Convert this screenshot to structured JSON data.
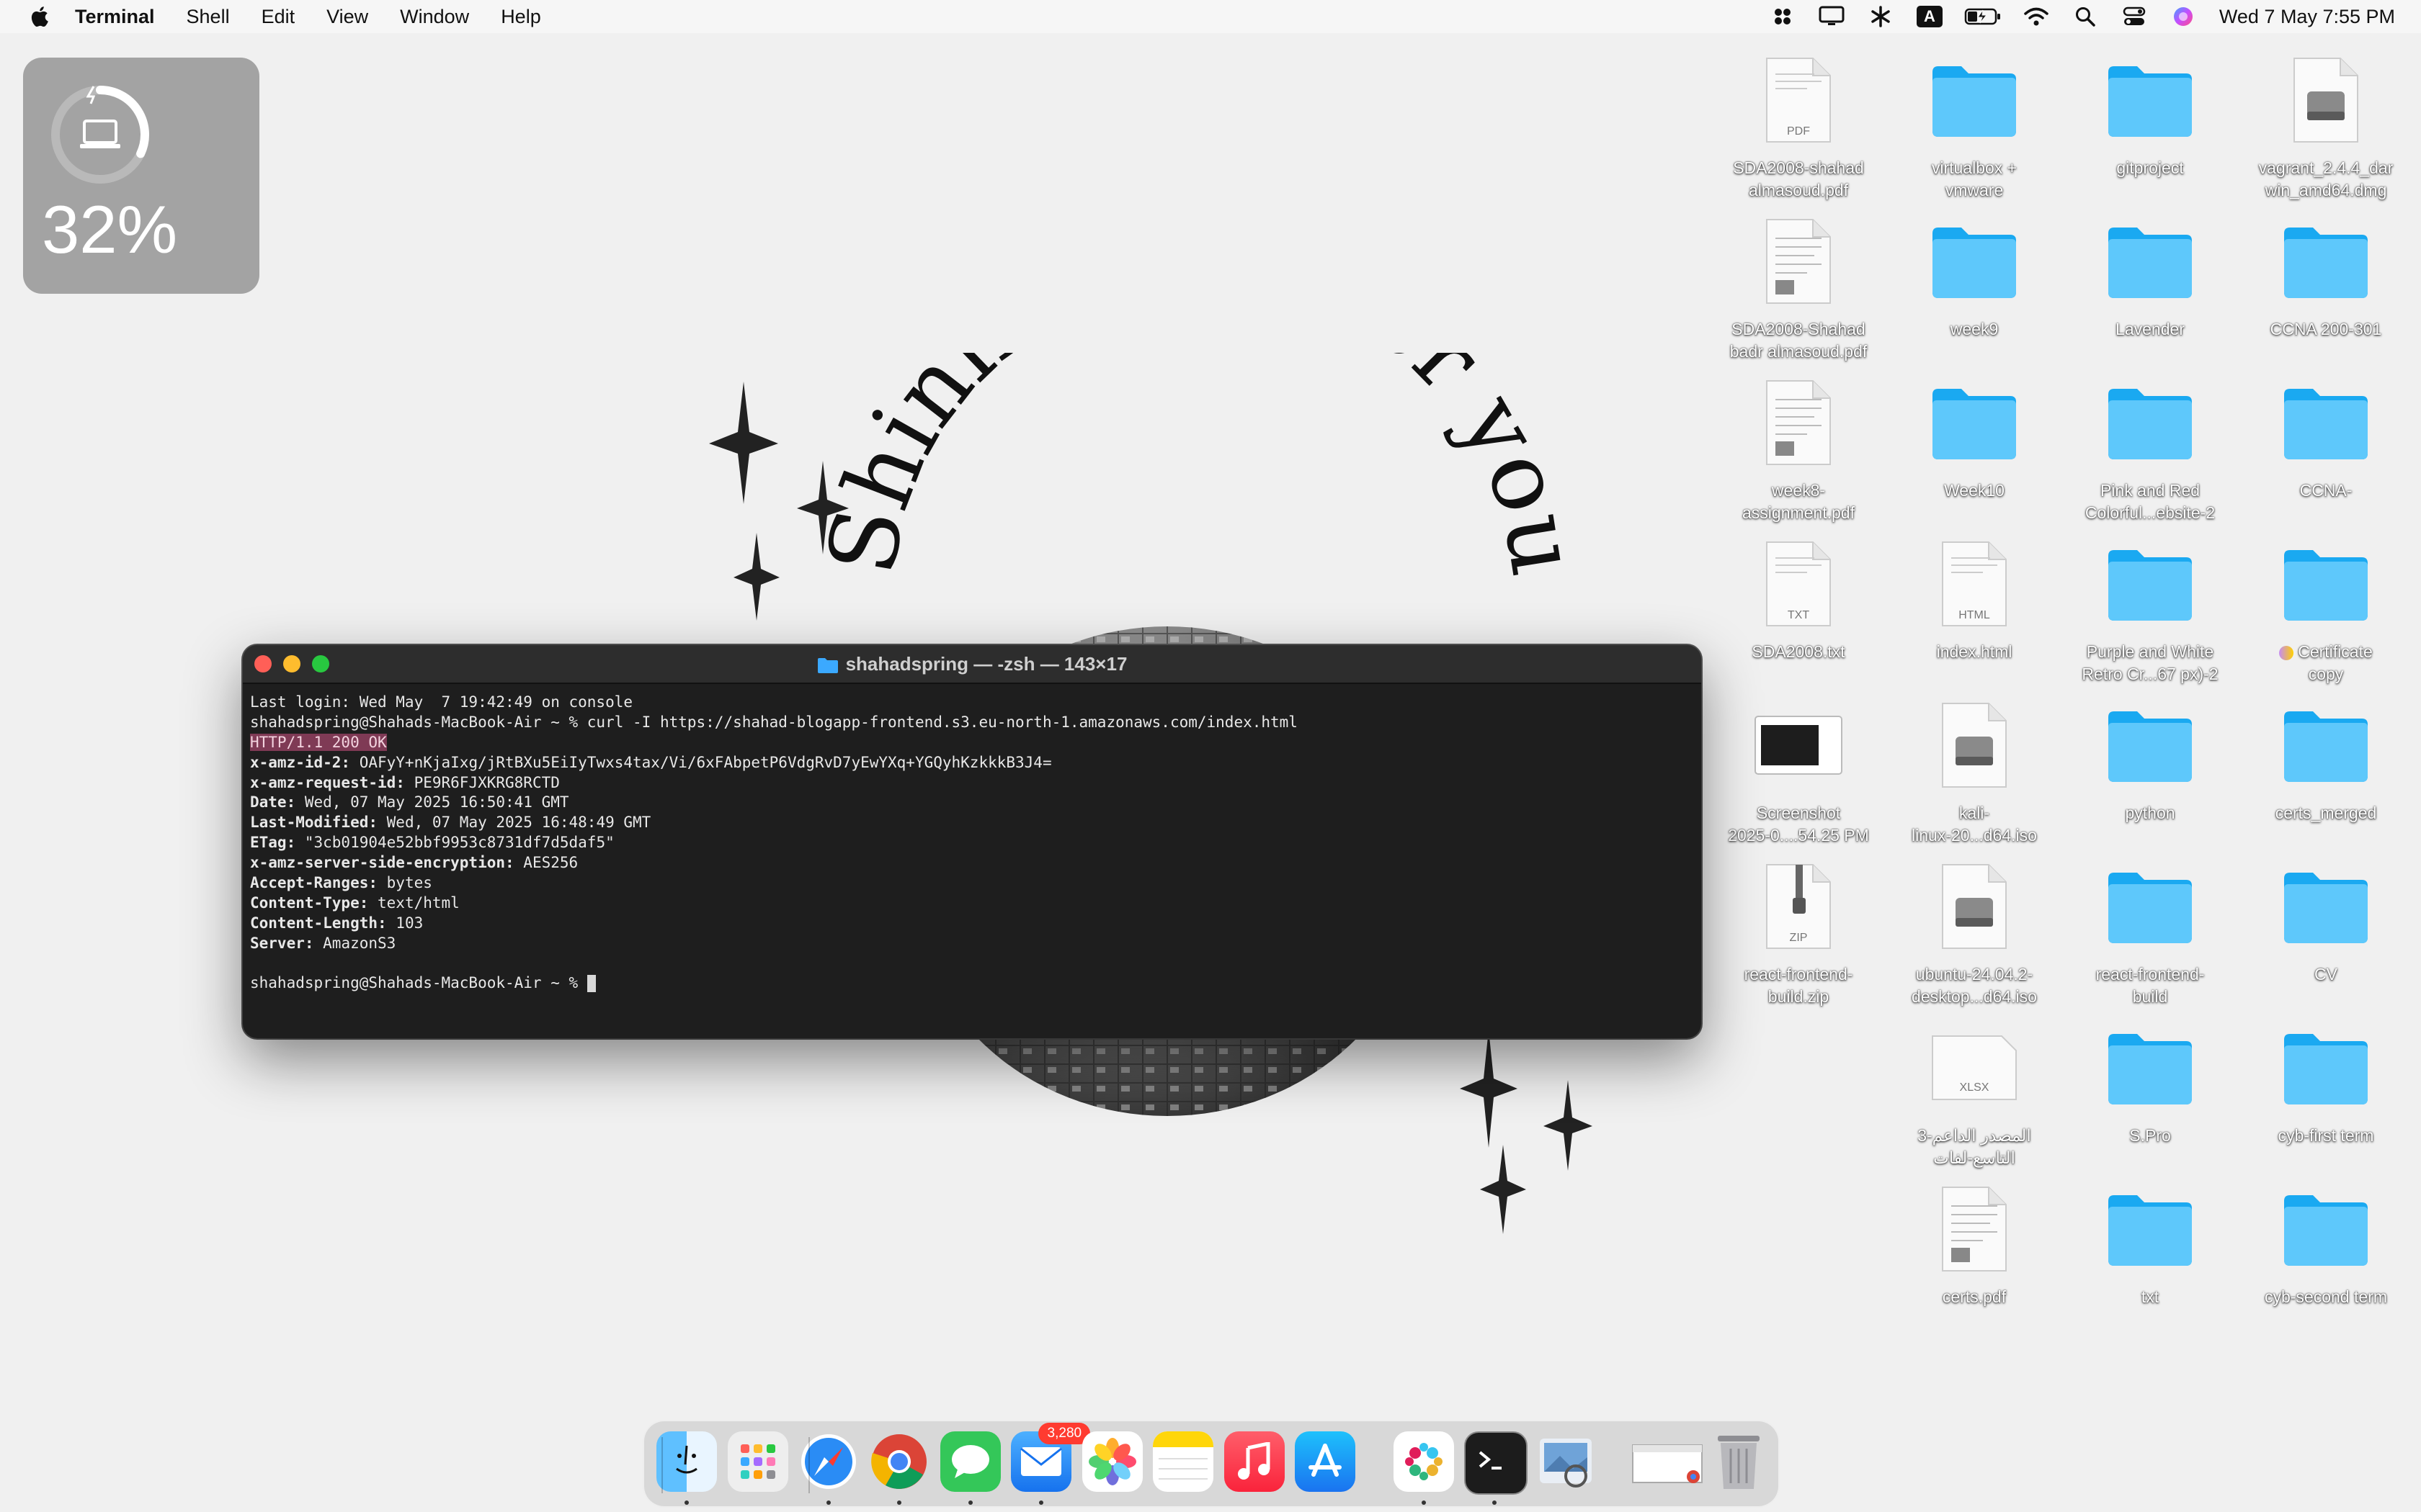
{
  "menubar": {
    "apple_icon": "apple-logo-icon",
    "app_name": "Terminal",
    "items": [
      "Shell",
      "Edit",
      "View",
      "Window",
      "Help"
    ],
    "status_icons": [
      "grid-icon",
      "display-icon",
      "bluetooth-icon",
      "input-source-icon",
      "battery-charging-icon",
      "wifi-icon",
      "search-icon",
      "control-center-icon",
      "siri-icon"
    ],
    "input_source_letter": "A",
    "clock": "Wed 7 May  7:55 PM"
  },
  "widget": {
    "battery_percent": "32%",
    "battery_level": 0.32
  },
  "wallpaper": {
    "text": "Shining just for you"
  },
  "desktop_icons": [
    {
      "label": "SDA2008-shahad\nalmasoud.pdf",
      "type": "pdf",
      "badge": "PDF"
    },
    {
      "label": "virtualbox +\nvmware",
      "type": "folder"
    },
    {
      "label": "gitproject",
      "type": "folder"
    },
    {
      "label": "vagrant_2.4.4_dar\nwin_amd64.dmg",
      "type": "disk"
    },
    {
      "label": "SDA2008-Shahad\nbadr almasoud.pdf",
      "type": "doc"
    },
    {
      "label": "week9",
      "type": "folder"
    },
    {
      "label": "Lavender",
      "type": "folder"
    },
    {
      "label": "CCNA 200-301",
      "type": "folder"
    },
    {
      "label": "week8-\nassignment.pdf",
      "type": "doc"
    },
    {
      "label": "Week10",
      "type": "folder"
    },
    {
      "label": "Pink and Red\nColorful...ebsite-2",
      "type": "folder"
    },
    {
      "label": "CCNA-",
      "type": "folder"
    },
    {
      "label": "SDA2008.txt",
      "type": "txt",
      "badge": "TXT"
    },
    {
      "label": "index.html",
      "type": "html",
      "badge": "HTML"
    },
    {
      "label": "Purple and White\nRetro Cr...67 px)-2",
      "type": "folder"
    },
    {
      "label": "Certificate\ncopy",
      "type": "folder",
      "tagged": true
    },
    {
      "label": "Screenshot\n2025-0....54.25 PM",
      "type": "screenshot"
    },
    {
      "label": "kali-\nlinux-20...d64.iso",
      "type": "disk"
    },
    {
      "label": "python",
      "type": "folder"
    },
    {
      "label": "certs_merged",
      "type": "folder"
    },
    {
      "label": "react-frontend-\nbuild.zip",
      "type": "zip",
      "badge": "ZIP"
    },
    {
      "label": "ubuntu-24.04.2-\ndesktop...d64.iso",
      "type": "disk"
    },
    {
      "label": "react-frontend-\nbuild",
      "type": "folder"
    },
    {
      "label": "CV",
      "type": "folder"
    },
    {
      "label": "3-المصدر الداعم\nالتاسع-لفات",
      "type": "xlsx",
      "badge": "XLSX"
    },
    {
      "label": "S.Pro",
      "type": "folder"
    },
    {
      "label": "cyb-first term",
      "type": "folder"
    },
    {
      "label": "certs.pdf",
      "type": "doc"
    },
    {
      "label": "txt",
      "type": "folder"
    },
    {
      "label": "cyb-second term",
      "type": "folder"
    }
  ],
  "terminal": {
    "title": "shahadspring — -zsh — 143×17",
    "lines": [
      {
        "k": "",
        "v": "Last login: Wed May  7 19:42:49 on console"
      },
      {
        "k": "",
        "v": "shahadspring@Shahads-MacBook-Air ~ % curl -I https://shahad-blogapp-frontend.s3.eu-north-1.amazonaws.com/index.html"
      },
      {
        "k": "",
        "v": "HTTP/1.1 200 OK",
        "highlight": true
      },
      {
        "k": "x-amz-id-2:",
        "v": " OAFyY+nKjaIxg/jRtBXu5EiIyTwxs4tax/Vi/6xFAbpetP6VdgRvD7yEwYXq+YGQyhKzkkkB3J4="
      },
      {
        "k": "x-amz-request-id:",
        "v": " PE9R6FJXKRG8RCTD"
      },
      {
        "k": "Date:",
        "v": " Wed, 07 May 2025 16:50:41 GMT"
      },
      {
        "k": "Last-Modified:",
        "v": " Wed, 07 May 2025 16:48:49 GMT"
      },
      {
        "k": "ETag:",
        "v": " \"3cb01904e52bbf9953c8731df7d5daf5\""
      },
      {
        "k": "x-amz-server-side-encryption:",
        "v": " AES256"
      },
      {
        "k": "Accept-Ranges:",
        "v": " bytes"
      },
      {
        "k": "Content-Type:",
        "v": " text/html"
      },
      {
        "k": "Content-Length:",
        "v": " 103"
      },
      {
        "k": "Server:",
        "v": " AmazonS3"
      },
      {
        "k": "",
        "v": ""
      },
      {
        "k": "",
        "v": "shahadspring@Shahads-MacBook-Air ~ % ",
        "cursor": true
      }
    ]
  },
  "dock": {
    "apps": [
      {
        "name": "Finder",
        "icon": "finder-icon",
        "running": true
      },
      {
        "name": "Launchpad",
        "icon": "launchpad-icon",
        "running": false
      },
      {
        "name": "Safari",
        "icon": "safari-icon",
        "running": true
      },
      {
        "name": "Chrome",
        "icon": "chrome-icon",
        "running": true
      },
      {
        "name": "Messages",
        "icon": "messages-icon",
        "running": true
      },
      {
        "name": "Mail",
        "icon": "mail-icon",
        "running": true,
        "badge": "3,280"
      },
      {
        "name": "Photos",
        "icon": "photos-icon",
        "running": false
      },
      {
        "name": "Notes",
        "icon": "notes-icon",
        "running": false
      },
      {
        "name": "Music",
        "icon": "music-icon",
        "running": false
      },
      {
        "name": "App Store",
        "icon": "app-store-icon",
        "running": false
      },
      {
        "name": "Slack",
        "icon": "slack-icon",
        "running": true
      },
      {
        "name": "Terminal",
        "icon": "terminal-icon",
        "running": true
      },
      {
        "name": "Preview",
        "icon": "preview-icon",
        "running": false
      },
      {
        "name": "Chrome Window",
        "icon": "window-thumbnail-icon",
        "running": false
      },
      {
        "name": "Trash",
        "icon": "trash-icon",
        "running": false
      }
    ]
  }
}
